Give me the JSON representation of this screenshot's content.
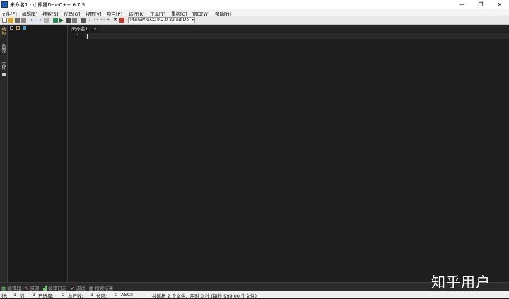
{
  "window": {
    "title": "未命名1 - 小熊猫Dev-C++ 6.7.5",
    "controls": [
      "—",
      "❐",
      "✕"
    ]
  },
  "menubar": {
    "items": [
      "文件[F]",
      "编辑[E]",
      "搜索[S]",
      "代码[O]",
      "视图[V]",
      "项目[P]",
      "运行[R]",
      "工具[T]",
      "重构[C]",
      "窗口[W]",
      "帮助[H]"
    ]
  },
  "toolbar": {
    "compiler_select": "MinGW GCC 9.2.0 32-bit De"
  },
  "left_tabs": [
    "结构",
    "监视",
    "文件"
  ],
  "editor": {
    "tab_label": "未命名1",
    "tab_close": "×",
    "line_numbers": [
      "1"
    ]
  },
  "bottom_tabs": [
    "编译器",
    "资源",
    "编译日志",
    "调试",
    "搜索结果"
  ],
  "statusbar": {
    "row_label": "行:",
    "row_value": "1",
    "col_label": "列:",
    "col_value": "1",
    "sel_label": "已选择:",
    "sel_value": "0",
    "lines_label": "总行数:",
    "lines_value": "1",
    "len_label": "长度:",
    "len_value": "0",
    "encoding": "ASCII",
    "message": "共解析 2 个文件，用时 0 秒 (每秒 999.00 个文件)"
  },
  "watermark": "知乎用户",
  "colors": {
    "editor_bg": "#1e1e1e",
    "accent": "#1a5fb4"
  }
}
